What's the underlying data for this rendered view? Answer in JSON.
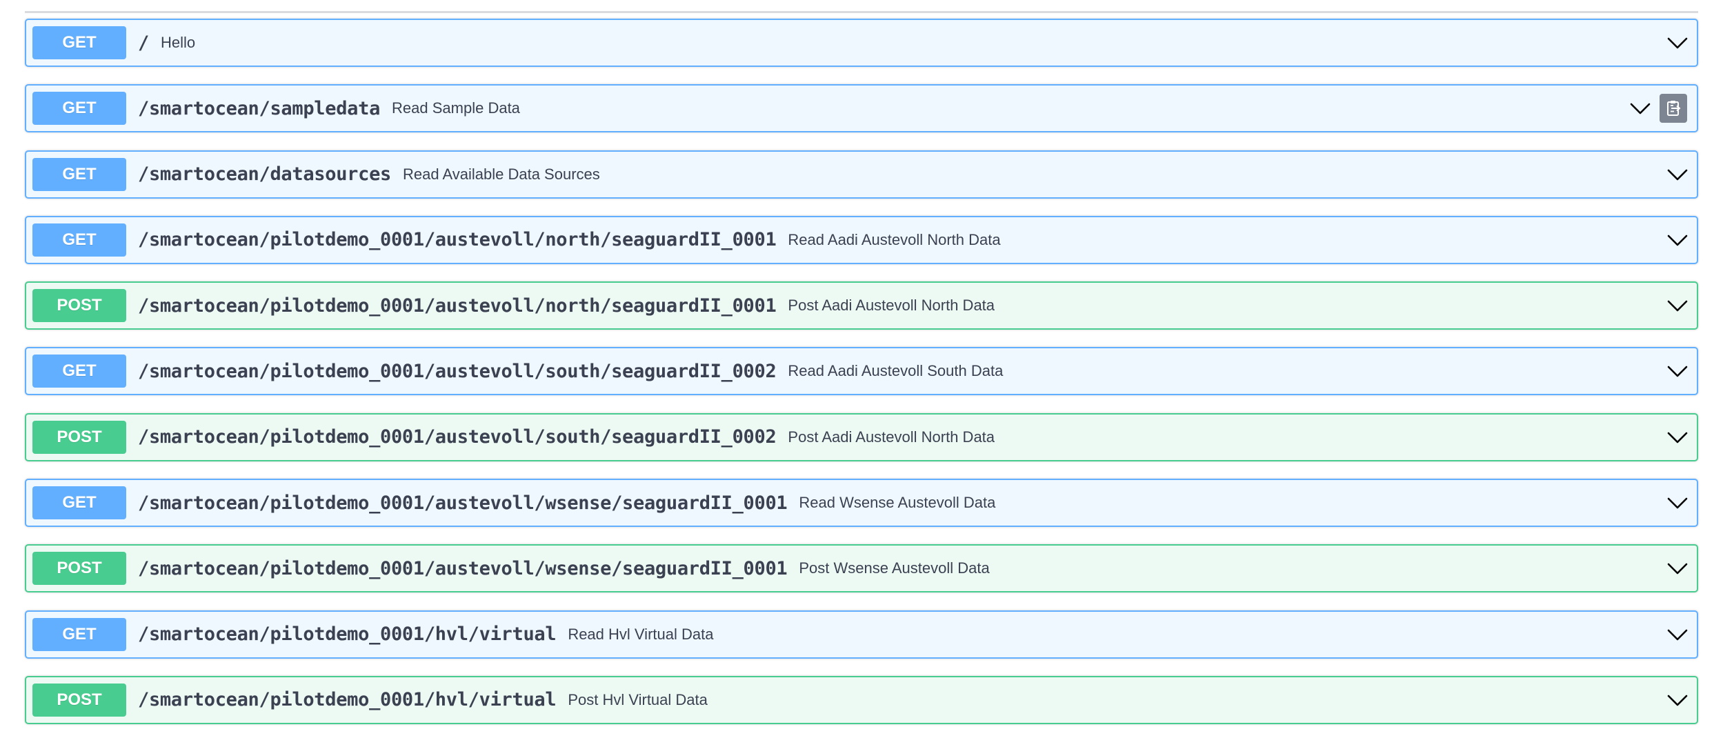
{
  "operations": [
    {
      "method": "GET",
      "path": "/",
      "summary": "Hello"
    },
    {
      "method": "GET",
      "path": "/smartocean/sampledata",
      "summary": "Read Sample Data"
    },
    {
      "method": "GET",
      "path": "/smartocean/datasources",
      "summary": "Read Available Data Sources"
    },
    {
      "method": "GET",
      "path": "/smartocean/pilotdemo_0001/austevoll/north/seaguardII_0001",
      "summary": "Read Aadi Austevoll North Data"
    },
    {
      "method": "POST",
      "path": "/smartocean/pilotdemo_0001/austevoll/north/seaguardII_0001",
      "summary": "Post Aadi Austevoll North Data"
    },
    {
      "method": "GET",
      "path": "/smartocean/pilotdemo_0001/austevoll/south/seaguardII_0002",
      "summary": "Read Aadi Austevoll South Data"
    },
    {
      "method": "POST",
      "path": "/smartocean/pilotdemo_0001/austevoll/south/seaguardII_0002",
      "summary": "Post Aadi Austevoll North Data"
    },
    {
      "method": "GET",
      "path": "/smartocean/pilotdemo_0001/austevoll/wsense/seaguardII_0001",
      "summary": "Read Wsense Austevoll Data"
    },
    {
      "method": "POST",
      "path": "/smartocean/pilotdemo_0001/austevoll/wsense/seaguardII_0001",
      "summary": "Post Wsense Austevoll Data"
    },
    {
      "method": "GET",
      "path": "/smartocean/pilotdemo_0001/hvl/virtual",
      "summary": "Read Hvl Virtual Data"
    },
    {
      "method": "POST",
      "path": "/smartocean/pilotdemo_0001/hvl/virtual",
      "summary": "Post Hvl Virtual Data"
    }
  ],
  "icons": {
    "expand": "chevron-down-icon",
    "copy": "clipboard-copy-icon"
  },
  "colors": {
    "get": "#61affe",
    "get_bg": "#eff7ff",
    "post": "#49cc90",
    "post_bg": "#edfaf3",
    "text": "#3b4151"
  }
}
